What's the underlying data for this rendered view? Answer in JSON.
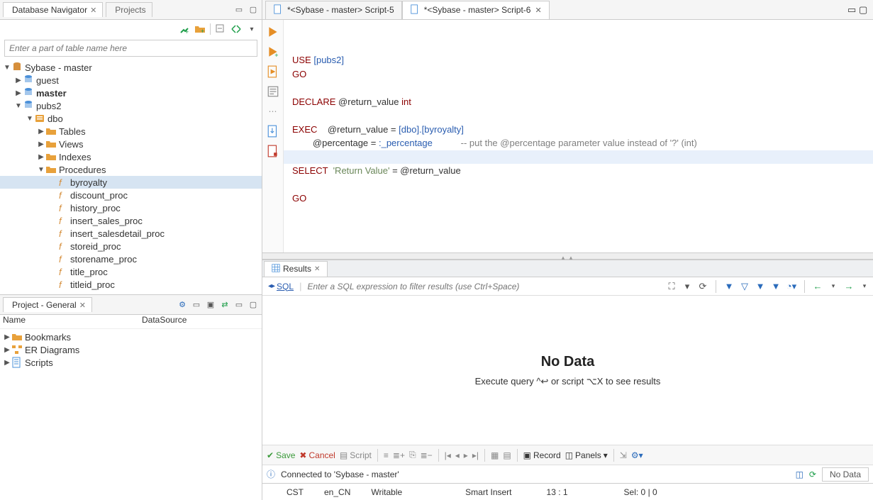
{
  "nav": {
    "tabs": {
      "dbnav": "Database Navigator",
      "projects": "Projects"
    },
    "filter_placeholder": "Enter a part of table name here",
    "tree": {
      "root": "Sybase - master",
      "guest": "guest",
      "master": "master",
      "pubs2": "pubs2",
      "dbo": "dbo",
      "tables": "Tables",
      "views": "Views",
      "indexes": "Indexes",
      "procedures": "Procedures",
      "procs": [
        "byroyalty",
        "discount_proc",
        "history_proc",
        "insert_sales_proc",
        "insert_salesdetail_proc",
        "storeid_proc",
        "storename_proc",
        "title_proc",
        "titleid_proc"
      ]
    }
  },
  "project": {
    "title": "Project - General",
    "cols": {
      "name": "Name",
      "ds": "DataSource"
    },
    "items": [
      "Bookmarks",
      "ER Diagrams",
      "Scripts"
    ]
  },
  "editor": {
    "tabs": [
      {
        "label": "*<Sybase - master> Script-5"
      },
      {
        "label": "*<Sybase - master> Script-6"
      }
    ],
    "sql": {
      "use": "USE",
      "usedb": "[pubs2]",
      "go": "GO",
      "declare": "DECLARE",
      "declvar": "@return_value",
      "decltype": "int",
      "exec": "EXEC",
      "exec_l1a": "@return_value = ",
      "exec_l1b": "[dbo].[byroyalty]",
      "exec_l2a": "@percentage = ",
      "exec_l2b": ":_percentage",
      "comment": "-- put the @percentage parameter value instead of '?' (int)",
      "select": "SELECT",
      "selstr": "'Return Value'",
      "seleq": " = @return_value"
    }
  },
  "results": {
    "tab": "Results",
    "sql_label": "SQL",
    "filter_placeholder": "Enter a SQL expression to filter results (use Ctrl+Space)",
    "nodata_title": "No Data",
    "nodata_msg": "Execute query ^↩ or script ⌥X to see results",
    "toolbar": {
      "save": "Save",
      "cancel": "Cancel",
      "script": "Script",
      "record": "Record",
      "panels": "Panels"
    },
    "conn": {
      "msg": "Connected to 'Sybase - master'",
      "status": "No Data"
    }
  },
  "status": {
    "tz": "CST",
    "locale": "en_CN",
    "writable": "Writable",
    "insert": "Smart Insert",
    "pos": "13 : 1",
    "sel": "Sel: 0 | 0"
  }
}
